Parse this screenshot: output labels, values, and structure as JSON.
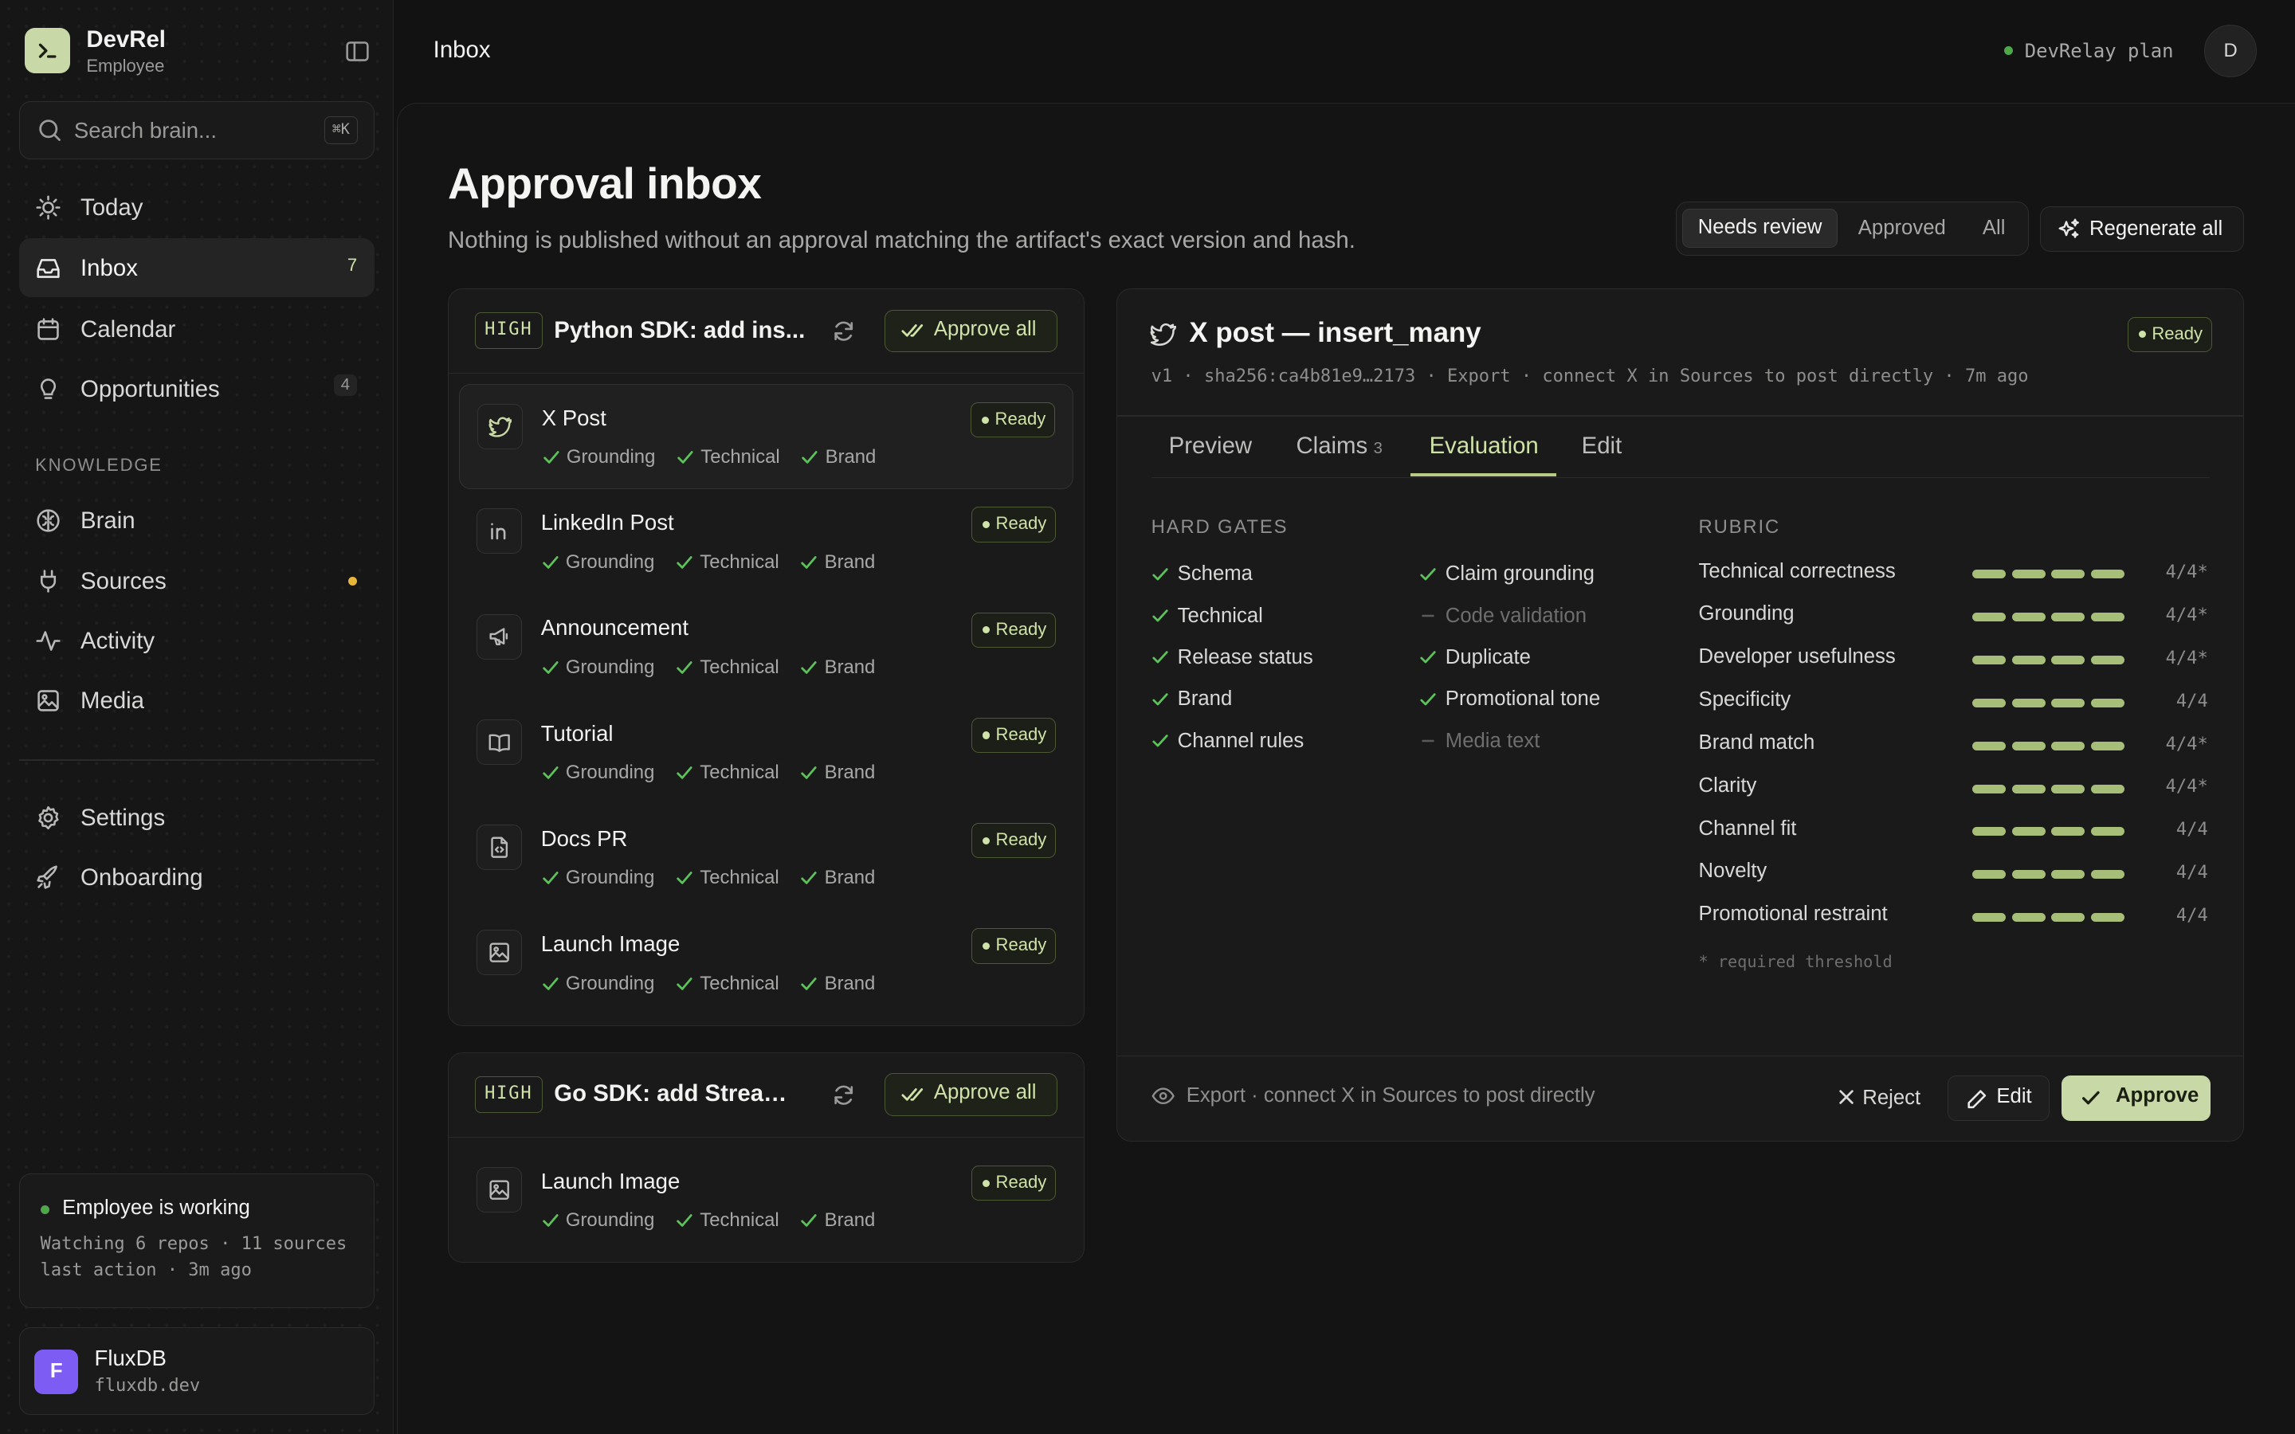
{
  "brand": {
    "name": "DevRel",
    "subtitle": "Employee"
  },
  "search": {
    "placeholder": "Search brain...",
    "shortcut": "⌘K"
  },
  "nav": [
    {
      "label": "Today",
      "icon": "sun-icon"
    },
    {
      "label": "Inbox",
      "icon": "inbox-icon",
      "count": "7",
      "active": true
    },
    {
      "label": "Calendar",
      "icon": "calendar-icon"
    },
    {
      "label": "Opportunities",
      "icon": "lightbulb-icon",
      "count": "4"
    }
  ],
  "knowledge": {
    "label": "KNOWLEDGE",
    "items": [
      {
        "label": "Brain",
        "icon": "brain-icon"
      },
      {
        "label": "Sources",
        "icon": "plug-icon",
        "dot_color": "#e5b53c"
      },
      {
        "label": "Activity",
        "icon": "activity-icon"
      },
      {
        "label": "Media",
        "icon": "image-icon"
      }
    ]
  },
  "bottom_nav": [
    {
      "label": "Settings",
      "icon": "gear-icon"
    },
    {
      "label": "Onboarding",
      "icon": "rocket-icon"
    }
  ],
  "status": {
    "title": "Employee is working",
    "line1": "Watching 6 repos · 11 sources",
    "line2": "last action · 3m ago"
  },
  "account": {
    "initial": "F",
    "name": "FluxDB",
    "domain": "fluxdb.dev"
  },
  "topbar": {
    "title": "Inbox",
    "plan": "DevRelay plan",
    "avatar": "D"
  },
  "page": {
    "title": "Approval inbox",
    "subtitle": "Nothing is published without an approval matching the artifact's exact version and hash.",
    "filters": [
      "Needs review",
      "Approved",
      "All"
    ],
    "active_filter": "Needs review",
    "regenerate_label": "Regenerate all"
  },
  "groups": [
    {
      "priority": "HIGH",
      "title": "Python SDK: add ins...",
      "approve_all": "Approve all",
      "items": [
        {
          "title": "X Post",
          "status": "Ready",
          "icon": "bird-icon",
          "checks": [
            "Grounding",
            "Technical",
            "Brand"
          ]
        },
        {
          "title": "LinkedIn Post",
          "status": "Ready",
          "icon": "linkedin-icon",
          "checks": [
            "Grounding",
            "Technical",
            "Brand"
          ]
        },
        {
          "title": "Announcement",
          "status": "Ready",
          "icon": "megaphone-icon",
          "checks": [
            "Grounding",
            "Technical",
            "Brand"
          ]
        },
        {
          "title": "Tutorial",
          "status": "Ready",
          "icon": "book-icon",
          "checks": [
            "Grounding",
            "Technical",
            "Brand"
          ]
        },
        {
          "title": "Docs PR",
          "status": "Ready",
          "icon": "file-code-icon",
          "checks": [
            "Grounding",
            "Technical",
            "Brand"
          ]
        },
        {
          "title": "Launch Image",
          "status": "Ready",
          "icon": "image-icon",
          "checks": [
            "Grounding",
            "Technical",
            "Brand"
          ]
        }
      ]
    },
    {
      "priority": "HIGH",
      "title": "Go SDK: add Stream(...",
      "approve_all": "Approve all",
      "items": [
        {
          "title": "Launch Image",
          "status": "Ready",
          "icon": "image-icon",
          "checks": [
            "Grounding",
            "Technical",
            "Brand"
          ]
        }
      ]
    }
  ],
  "detail": {
    "title": "X post — insert_many",
    "status": "Ready",
    "meta": "v1 · sha256:ca4b81e9…2173 · Export · connect X in Sources to post directly · 7m ago",
    "tabs": [
      {
        "label": "Preview"
      },
      {
        "label": "Claims",
        "count": "3"
      },
      {
        "label": "Evaluation",
        "active": true
      },
      {
        "label": "Edit"
      }
    ],
    "hard_gates_label": "HARD GATES",
    "hard_gates": [
      {
        "label": "Schema",
        "passed": true
      },
      {
        "label": "Technical",
        "passed": true
      },
      {
        "label": "Release status",
        "passed": true
      },
      {
        "label": "Brand",
        "passed": true
      },
      {
        "label": "Channel rules",
        "passed": true
      },
      {
        "label": "Claim grounding",
        "passed": true
      },
      {
        "label": "Code validation",
        "passed": false
      },
      {
        "label": "Duplicate",
        "passed": true
      },
      {
        "label": "Promotional tone",
        "passed": true
      },
      {
        "label": "Media text",
        "passed": false
      }
    ],
    "rubric_label": "RUBRIC",
    "rubric": [
      {
        "name": "Technical correctness",
        "score": "4/4*",
        "value": 4
      },
      {
        "name": "Grounding",
        "score": "4/4*",
        "value": 4
      },
      {
        "name": "Developer usefulness",
        "score": "4/4*",
        "value": 4
      },
      {
        "name": "Specificity",
        "score": "4/4",
        "value": 4
      },
      {
        "name": "Brand match",
        "score": "4/4*",
        "value": 4
      },
      {
        "name": "Clarity",
        "score": "4/4*",
        "value": 4
      },
      {
        "name": "Channel fit",
        "score": "4/4",
        "value": 4
      },
      {
        "name": "Novelty",
        "score": "4/4",
        "value": 4
      },
      {
        "name": "Promotional restraint",
        "score": "4/4",
        "value": 4
      }
    ],
    "required_note": "* required threshold",
    "footer_note": "Export · connect X in Sources to post directly",
    "reject_label": "Reject",
    "edit_label": "Edit",
    "approve_label": "Approve"
  },
  "colors": {
    "accent": "#c8d9a7",
    "accent_text": "#cfe3a9",
    "success": "#4ea84a",
    "warning": "#e5b53c",
    "avatar": "#7c5cf2"
  }
}
